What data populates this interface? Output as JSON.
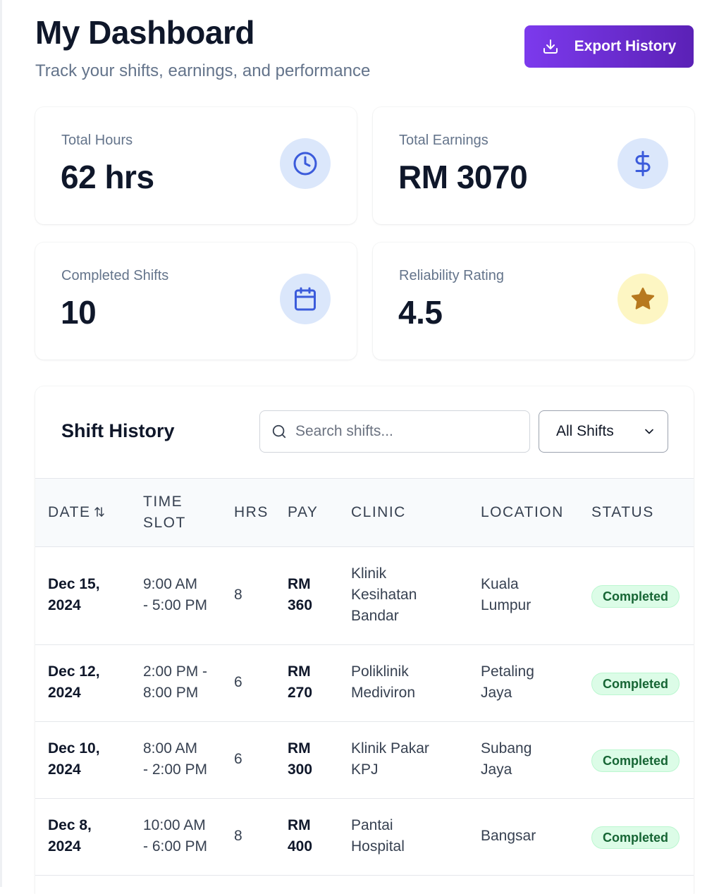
{
  "header": {
    "title": "My Dashboard",
    "subtitle": "Track your shifts, earnings, and performance",
    "export_label": "Export History"
  },
  "stats": [
    {
      "label": "Total Hours",
      "value": "62 hrs",
      "icon": "clock-icon",
      "icon_color": "#3b5bdb",
      "icon_bg": "#dbe7fb"
    },
    {
      "label": "Total Earnings",
      "value": "RM 3070",
      "icon": "dollar-icon",
      "icon_color": "#3b5bdb",
      "icon_bg": "#dbe7fb"
    },
    {
      "label": "Completed Shifts",
      "value": "10",
      "icon": "calendar-icon",
      "icon_color": "#3b5bdb",
      "icon_bg": "#dbe7fb"
    },
    {
      "label": "Reliability Rating",
      "value": "4.5",
      "icon": "star-icon",
      "icon_color": "#b7791f",
      "icon_bg": "#fdf6c3"
    }
  ],
  "history": {
    "title": "Shift History",
    "search_placeholder": "Search shifts...",
    "filter_value": "All Shifts",
    "columns": {
      "date": "Date",
      "time_line1": "Time",
      "time_line2": "Slot",
      "hrs": "Hrs",
      "pay": "Pay",
      "clinic": "Clinic",
      "location": "Location",
      "status": "Status"
    },
    "rows": [
      {
        "date1": "Dec 15,",
        "date2": "2024",
        "time1": "9:00 AM",
        "time2": "- 5:00 PM",
        "hrs": "8",
        "pay1": "RM",
        "pay2": "360",
        "clinic": [
          "Klinik",
          "Kesihatan",
          "Bandar"
        ],
        "location": [
          "Kuala",
          "Lumpur"
        ],
        "status": "Completed"
      },
      {
        "date1": "Dec 12,",
        "date2": "2024",
        "time1": "2:00 PM -",
        "time2": "8:00 PM",
        "hrs": "6",
        "pay1": "RM",
        "pay2": "270",
        "clinic": [
          "Poliklinik",
          "Mediviron"
        ],
        "location": [
          "Petaling",
          "Jaya"
        ],
        "status": "Completed"
      },
      {
        "date1": "Dec 10,",
        "date2": "2024",
        "time1": "8:00 AM",
        "time2": "- 2:00 PM",
        "hrs": "6",
        "pay1": "RM",
        "pay2": "300",
        "clinic": [
          "Klinik Pakar",
          "KPJ"
        ],
        "location": [
          "Subang",
          "Jaya"
        ],
        "status": "Completed"
      },
      {
        "date1": "Dec 8,",
        "date2": "2024",
        "time1": "10:00 AM",
        "time2": "- 6:00 PM",
        "hrs": "8",
        "pay1": "RM",
        "pay2": "400",
        "clinic": [
          "Pantai",
          "Hospital"
        ],
        "location": [
          "Bangsar"
        ],
        "status": "Completed"
      }
    ],
    "status_color": "#166534",
    "status_bg": "#dcfce7"
  },
  "colors": {
    "accent": "#6d28d9",
    "title": "#0f172a",
    "muted": "#64748b"
  }
}
